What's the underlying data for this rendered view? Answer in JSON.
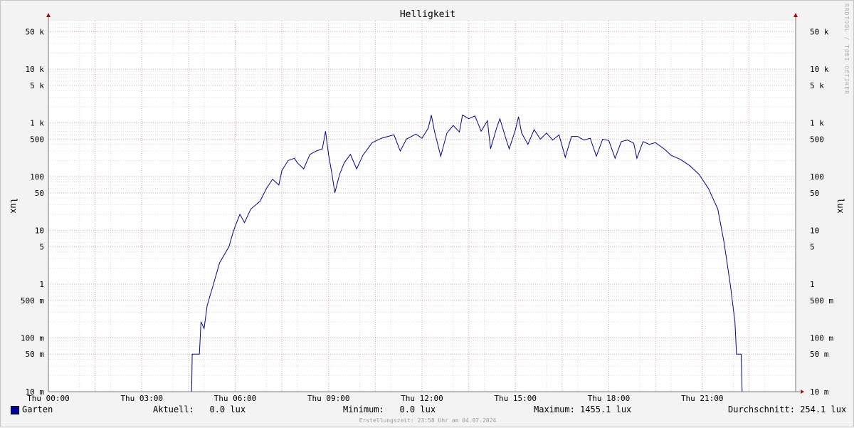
{
  "chart_data": {
    "type": "line",
    "title": "Helligkeit",
    "ylabel": "lux",
    "y_scale": "log",
    "ylim": [
      0.01,
      80000
    ],
    "xlim_hours": [
      0,
      24
    ],
    "x_ticks": [
      {
        "h": 0,
        "label": "Thu 00:00"
      },
      {
        "h": 3,
        "label": "Thu 03:00"
      },
      {
        "h": 6,
        "label": "Thu 06:00"
      },
      {
        "h": 9,
        "label": "Thu 09:00"
      },
      {
        "h": 12,
        "label": "Thu 12:00"
      },
      {
        "h": 15,
        "label": "Thu 15:00"
      },
      {
        "h": 18,
        "label": "Thu 18:00"
      },
      {
        "h": 21,
        "label": "Thu 21:00"
      }
    ],
    "y_ticks": [
      {
        "v": 50000,
        "label": "50 k"
      },
      {
        "v": 10000,
        "label": "10 k"
      },
      {
        "v": 5000,
        "label": "5 k"
      },
      {
        "v": 1000,
        "label": "1 k"
      },
      {
        "v": 500,
        "label": "500"
      },
      {
        "v": 100,
        "label": "100"
      },
      {
        "v": 50,
        "label": "50"
      },
      {
        "v": 10,
        "label": "10"
      },
      {
        "v": 5,
        "label": "5"
      },
      {
        "v": 1,
        "label": "1"
      },
      {
        "v": 0.5,
        "label": "500 m"
      },
      {
        "v": 0.1,
        "label": "100 m"
      },
      {
        "v": 0.05,
        "label": "50 m"
      },
      {
        "v": 0.01,
        "label": "10 m"
      }
    ],
    "grid": true,
    "series": [
      {
        "name": "Garten",
        "color": "#0000a0",
        "points": [
          [
            0,
            0.01
          ],
          [
            4.6,
            0.01
          ],
          [
            4.62,
            0.05
          ],
          [
            4.85,
            0.05
          ],
          [
            4.9,
            0.2
          ],
          [
            5.0,
            0.15
          ],
          [
            5.1,
            0.4
          ],
          [
            5.3,
            1.0
          ],
          [
            5.5,
            2.5
          ],
          [
            5.8,
            5.0
          ],
          [
            5.9,
            8
          ],
          [
            6.0,
            12
          ],
          [
            6.15,
            20
          ],
          [
            6.3,
            14
          ],
          [
            6.5,
            25
          ],
          [
            6.8,
            35
          ],
          [
            7.0,
            60
          ],
          [
            7.2,
            90
          ],
          [
            7.4,
            70
          ],
          [
            7.5,
            130
          ],
          [
            7.7,
            200
          ],
          [
            7.9,
            220
          ],
          [
            8.0,
            180
          ],
          [
            8.2,
            140
          ],
          [
            8.4,
            260
          ],
          [
            8.6,
            300
          ],
          [
            8.8,
            330
          ],
          [
            8.9,
            700
          ],
          [
            9.0,
            250
          ],
          [
            9.1,
            120
          ],
          [
            9.2,
            50
          ],
          [
            9.35,
            110
          ],
          [
            9.5,
            180
          ],
          [
            9.7,
            260
          ],
          [
            9.9,
            140
          ],
          [
            10.1,
            250
          ],
          [
            10.4,
            430
          ],
          [
            10.7,
            520
          ],
          [
            10.9,
            560
          ],
          [
            11.1,
            600
          ],
          [
            11.3,
            300
          ],
          [
            11.5,
            500
          ],
          [
            11.8,
            620
          ],
          [
            12.0,
            520
          ],
          [
            12.2,
            800
          ],
          [
            12.3,
            1400
          ],
          [
            12.4,
            700
          ],
          [
            12.6,
            240
          ],
          [
            12.8,
            650
          ],
          [
            13.0,
            900
          ],
          [
            13.2,
            680
          ],
          [
            13.3,
            1400
          ],
          [
            13.5,
            1200
          ],
          [
            13.7,
            1350
          ],
          [
            13.9,
            700
          ],
          [
            14.1,
            1100
          ],
          [
            14.2,
            330
          ],
          [
            14.4,
            820
          ],
          [
            14.5,
            1200
          ],
          [
            14.7,
            500
          ],
          [
            14.8,
            330
          ],
          [
            15.0,
            750
          ],
          [
            15.1,
            1300
          ],
          [
            15.2,
            650
          ],
          [
            15.4,
            400
          ],
          [
            15.6,
            750
          ],
          [
            15.8,
            500
          ],
          [
            16.0,
            650
          ],
          [
            16.2,
            480
          ],
          [
            16.4,
            600
          ],
          [
            16.6,
            230
          ],
          [
            16.8,
            560
          ],
          [
            17.0,
            560
          ],
          [
            17.2,
            480
          ],
          [
            17.4,
            520
          ],
          [
            17.6,
            240
          ],
          [
            17.8,
            500
          ],
          [
            18.0,
            470
          ],
          [
            18.2,
            220
          ],
          [
            18.4,
            450
          ],
          [
            18.6,
            480
          ],
          [
            18.8,
            420
          ],
          [
            18.9,
            220
          ],
          [
            19.1,
            450
          ],
          [
            19.3,
            400
          ],
          [
            19.5,
            430
          ],
          [
            19.8,
            320
          ],
          [
            20.0,
            250
          ],
          [
            20.3,
            210
          ],
          [
            20.6,
            160
          ],
          [
            20.9,
            110
          ],
          [
            21.2,
            60
          ],
          [
            21.5,
            25
          ],
          [
            21.7,
            6
          ],
          [
            21.9,
            1
          ],
          [
            22.05,
            0.2
          ],
          [
            22.1,
            0.05
          ],
          [
            22.25,
            0.05
          ],
          [
            22.28,
            0.01
          ],
          [
            24,
            0.01
          ]
        ]
      }
    ]
  },
  "legend": {
    "series_name": "Garten",
    "current": "Aktuell:   0.0 lux",
    "minimum": "Minimum:   0.0 lux",
    "maximum": "Maximum: 1455.1 lux",
    "average": "Durchschnitt: 254.1 lux"
  },
  "footer": "Erstellungszeit: 23:58 Uhr am 04.07.2024",
  "watermark": "RRDTOOL / TOBI OETIKER"
}
